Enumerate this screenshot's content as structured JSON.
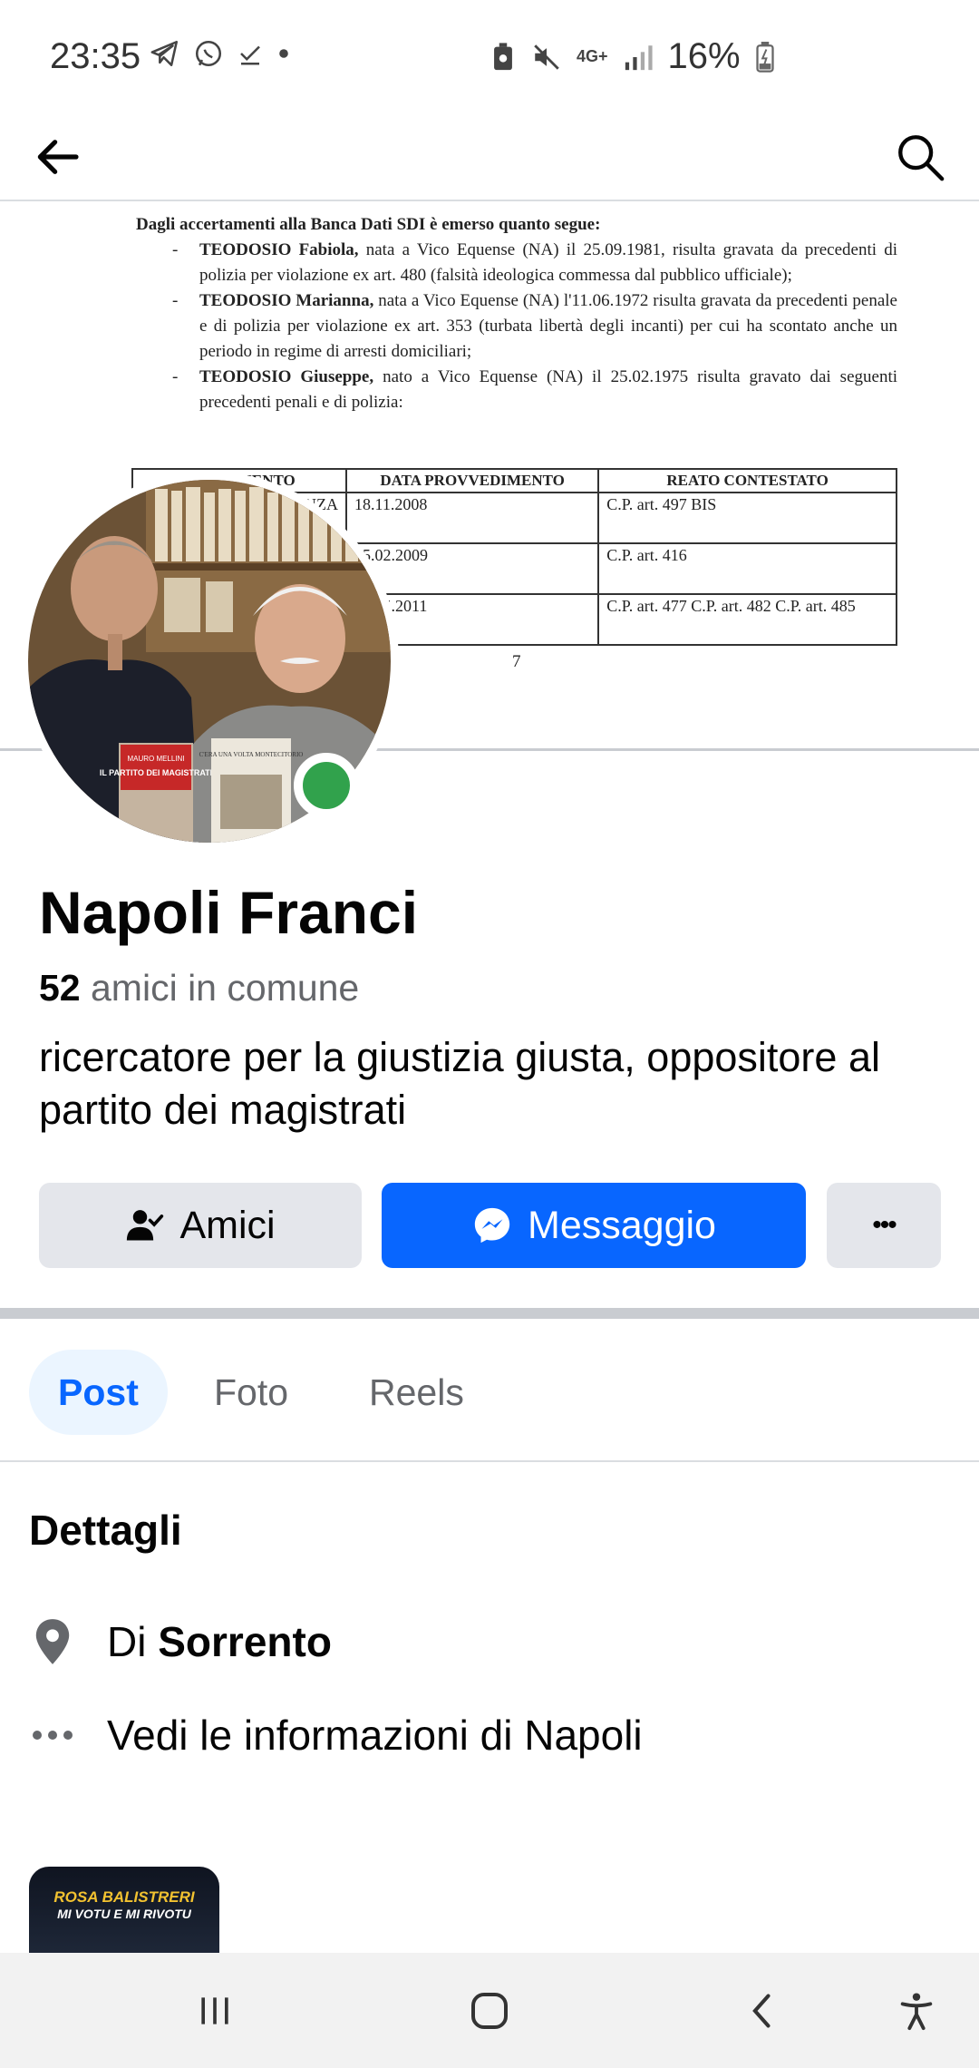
{
  "status_bar": {
    "time": "23:35",
    "network": "4G+",
    "battery": "16%"
  },
  "cover": {
    "heading": "Dagli accertamenti alla Banca Dati SDI è emerso quanto segue:",
    "items": [
      {
        "name": "TEODOSIO Fabiola,",
        "text": " nata a Vico Equense (NA) il 25.09.1981, risulta gravata da precedenti di polizia per violazione ex art. 480 (falsità ideologica commessa dal pubblico ufficiale);"
      },
      {
        "name": "TEODOSIO Marianna,",
        "text": " nata a Vico Equense (NA) l'11.06.1972 risulta gravata da precedenti penale e di polizia per violazione ex art. 353 (turbata libertà degli incanti) per cui ha scontato anche un periodo in regime di arresti domiciliari;"
      },
      {
        "name": "TEODOSIO Giuseppe,",
        "text": " nato a Vico Equense (NA) il 25.02.1975 risulta gravato dai seguenti precedenti penali e di polizia:"
      }
    ],
    "table": {
      "headers": [
        "…VEDIMENTO",
        "DATA PROVVEDIMENTO",
        "REATO CONTESTATO"
      ],
      "rows": [
        [
          "…NZA",
          "18.11.2008",
          "C.P. art. 497 BIS"
        ],
        [
          "",
          "05.02.2009",
          "C.P. art. 416"
        ],
        [
          "",
          "13.05.2011",
          "C.P. art. 477 C.P. art. 482 C.P. art. 485"
        ]
      ]
    },
    "page_number": "7"
  },
  "avatar": {
    "book_left_title": "IL PARTITO DEI MAGISTRATI",
    "book_left_author": "MAURO MELLINI",
    "book_right_title": "C'ERA UNA VOLTA MONTECITORIO",
    "online_color": "#31a24c"
  },
  "profile": {
    "name": "Napoli Franci",
    "mutual_count": "52",
    "mutual_label": " amici in comune",
    "bio": "ricercatore per la giustizia giusta, oppositore al partito dei magistrati"
  },
  "actions": {
    "friends_label": "Amici",
    "message_label": "Messaggio",
    "more_label": "•••"
  },
  "tabs": [
    {
      "label": "Post",
      "active": true
    },
    {
      "label": "Foto",
      "active": false
    },
    {
      "label": "Reels",
      "active": false
    }
  ],
  "details": {
    "title": "Dettagli",
    "location_prefix": "Di ",
    "location_city": "Sorrento",
    "info_link": "Vedi le informazioni di Napoli"
  },
  "highlight": {
    "title": "ROSA BALISTRERI",
    "subtitle": "MI VOTU E MI RIVOTU"
  },
  "colors": {
    "accent": "#0866ff",
    "button_gray": "#e4e6eb",
    "secondary_text": "#65676b",
    "tab_active_bg": "#ebf5ff"
  },
  "icons": {
    "back": "arrow-left-icon",
    "search": "search-icon",
    "friends": "person-check-icon",
    "message": "messenger-icon",
    "location": "map-pin-icon",
    "more": "ellipsis-icon"
  }
}
